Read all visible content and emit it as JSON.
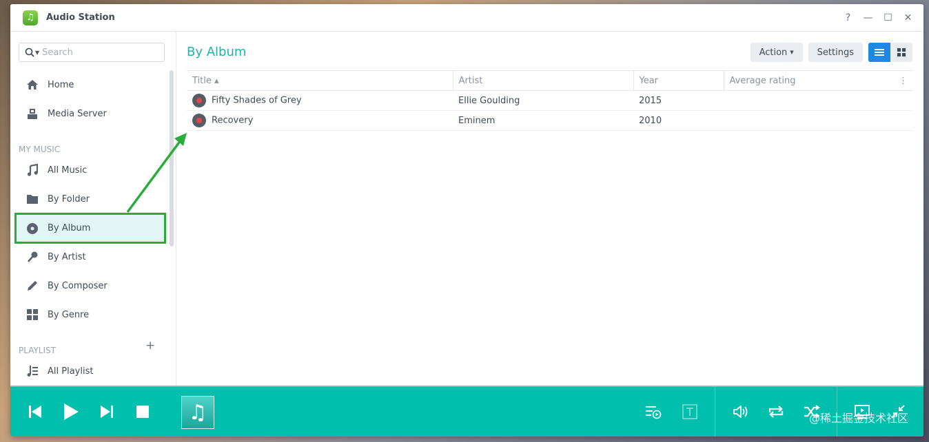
{
  "window": {
    "title": "Audio Station",
    "help": "?",
    "minimize": "—",
    "maximize": "☐",
    "close": "✕"
  },
  "search": {
    "placeholder": "Search"
  },
  "sidebar": {
    "items": [
      {
        "label": "Home"
      },
      {
        "label": "Media Server"
      }
    ],
    "my_music_label": "MY MUSIC",
    "music_items": [
      {
        "label": "All Music"
      },
      {
        "label": "By Folder"
      },
      {
        "label": "By Album"
      },
      {
        "label": "By Artist"
      },
      {
        "label": "By Composer"
      },
      {
        "label": "By Genre"
      }
    ],
    "playlist_label": "PLAYLIST",
    "playlist_add": "+",
    "playlist_items": [
      {
        "label": "All Playlist"
      }
    ]
  },
  "main": {
    "title": "By Album",
    "action_label": "Action",
    "settings_label": "Settings",
    "columns": [
      "Title ▴",
      "Artist",
      "Year",
      "Average rating"
    ],
    "rows": [
      {
        "title": "Fifty Shades of Grey",
        "artist": "Ellie Goulding",
        "year": "2015",
        "rating": ""
      },
      {
        "title": "Recovery",
        "artist": "Eminem",
        "year": "2010",
        "rating": ""
      }
    ]
  },
  "player": {
    "watermark": "@稀土掘金技术社区"
  },
  "colors": {
    "accent": "#1cb3ad",
    "player_bg": "#00bfad",
    "highlight": "#27ad3a"
  }
}
